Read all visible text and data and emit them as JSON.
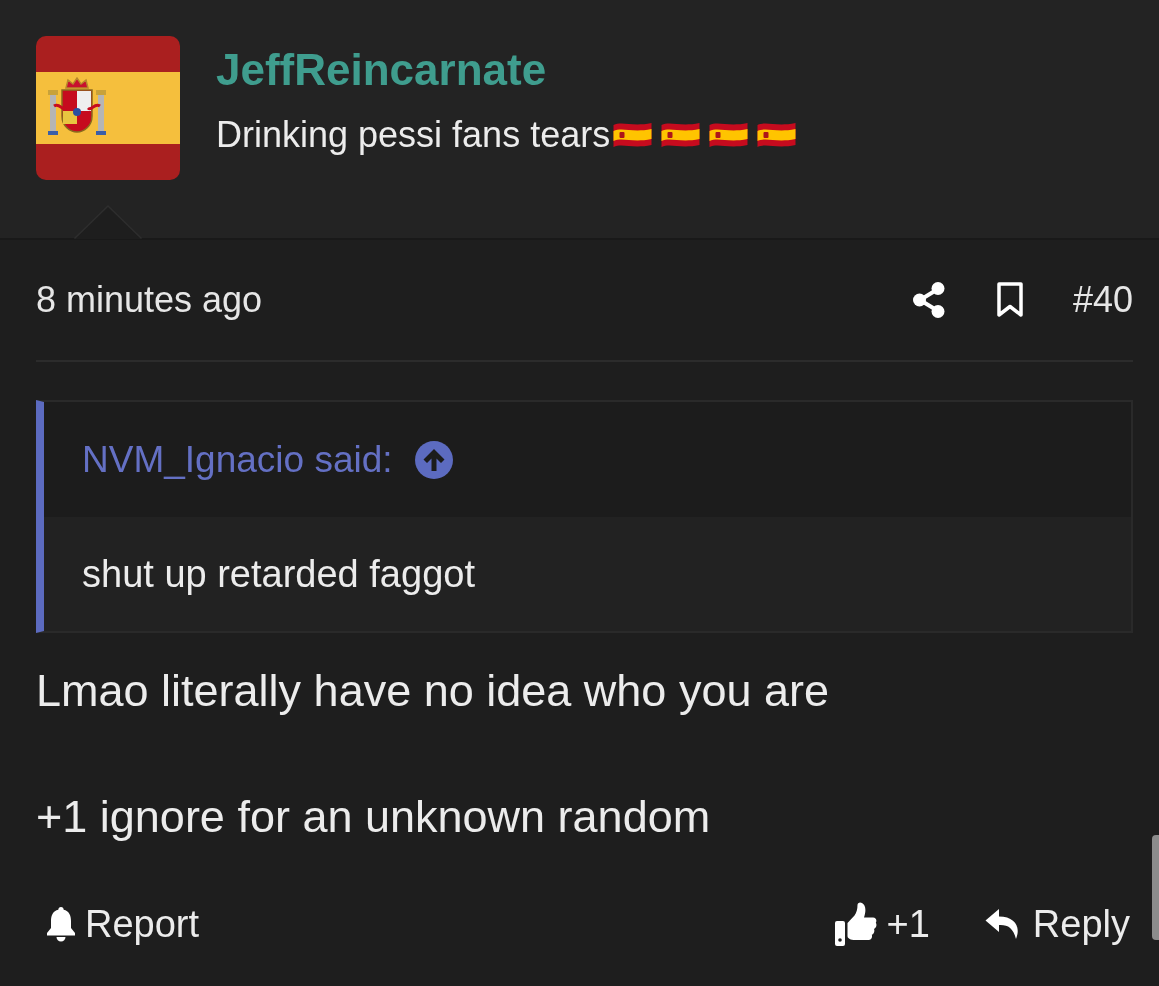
{
  "post": {
    "author": {
      "name": "JeffReincarnate",
      "signature": {
        "text": "Drinking pessi fans tears",
        "icons": [
          {
            "kind": "flag"
          },
          {
            "kind": "flag"
          },
          {
            "kind": "flag"
          },
          {
            "kind": "flag"
          }
        ]
      }
    },
    "meta": {
      "time": "8 minutes ago",
      "bookmarked": false,
      "number": "#40"
    },
    "quote": {
      "author": "NVM_Ignacio said:",
      "text": "shut up retarded faggot"
    },
    "body": [
      "Lmao literally have no idea who you are",
      "+1 ignore for an unknown random"
    ],
    "actions": [
      {
        "kind": "report",
        "label": "Report"
      },
      {
        "kind": "like",
        "label": "+1"
      },
      {
        "kind": "reply",
        "label": "Reply"
      }
    ]
  }
}
